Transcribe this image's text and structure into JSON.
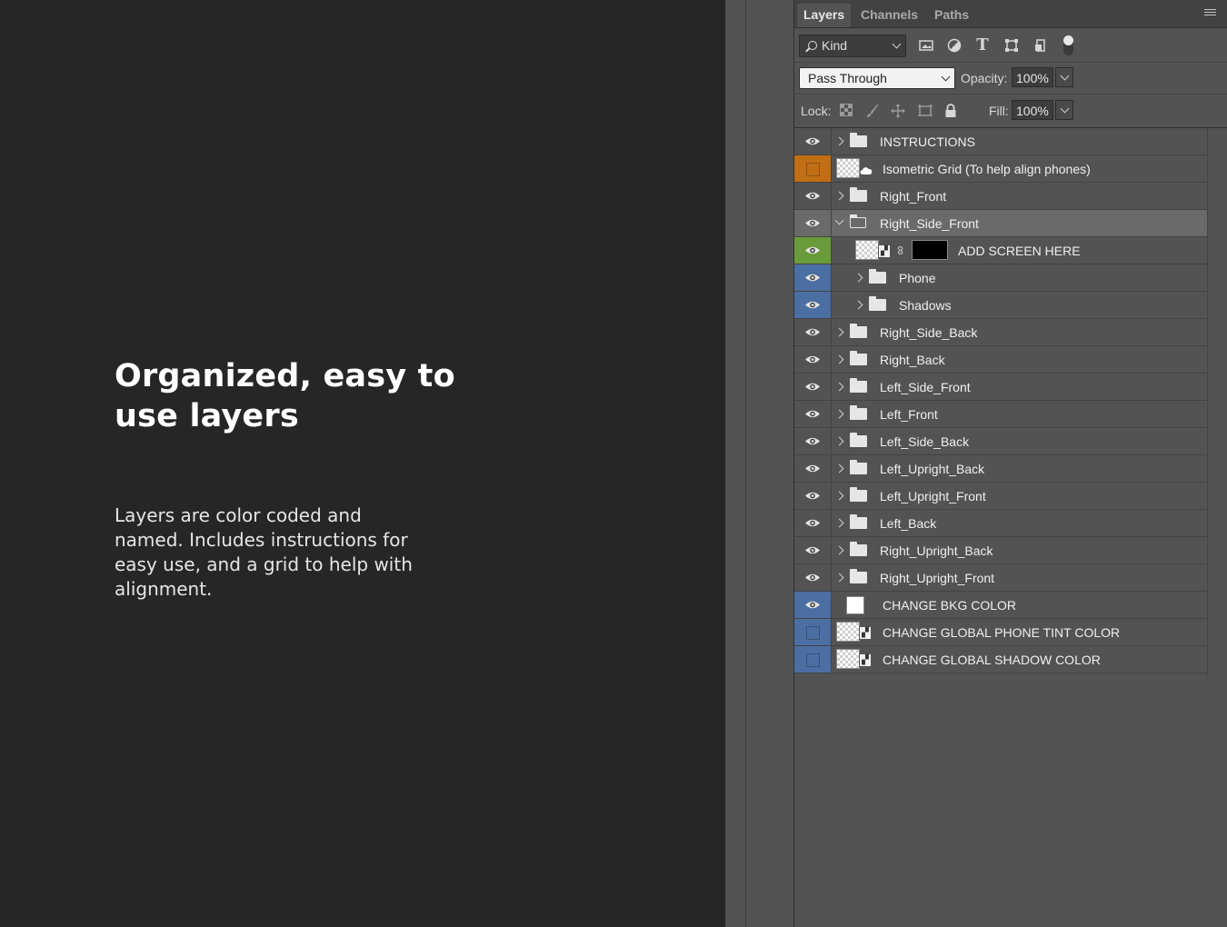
{
  "promo": {
    "headline": "Organized, easy to use layers",
    "description": "Layers are color coded and named. Includes instructions for easy use, and a grid to help with alignment."
  },
  "tabs": [
    {
      "label": "Layers",
      "active": true
    },
    {
      "label": "Channels",
      "active": false
    },
    {
      "label": "Paths",
      "active": false
    }
  ],
  "filter": {
    "kind_label": "Kind",
    "icons": [
      "image-filter-icon",
      "adjustment-filter-icon",
      "type-filter-icon",
      "shape-filter-icon",
      "smart-object-filter-icon"
    ]
  },
  "blend": {
    "mode": "Pass Through",
    "opacity_label": "Opacity:",
    "opacity": "100%",
    "lock_label": "Lock:",
    "fill_label": "Fill:",
    "fill": "100%"
  },
  "colors": {
    "panel": "#535353",
    "orange": "#c16e15",
    "green": "#6a9b3a",
    "blue": "#4b6fa3"
  },
  "layers": [
    {
      "name": "INSTRUCTIONS",
      "type": "group",
      "visible": true,
      "color": "none",
      "indent": 0,
      "expanded": false
    },
    {
      "name": "Isometric Grid (To help align phones)",
      "type": "smart-cloud",
      "visible": false,
      "color": "orange",
      "indent": 0
    },
    {
      "name": "Right_Front",
      "type": "group",
      "visible": true,
      "color": "none",
      "indent": 0,
      "expanded": false
    },
    {
      "name": "Right_Side_Front",
      "type": "group",
      "visible": true,
      "color": "none",
      "indent": 0,
      "expanded": true,
      "selected": true
    },
    {
      "name": "ADD SCREEN HERE",
      "type": "smart-mask",
      "visible": true,
      "color": "green",
      "indent": 1
    },
    {
      "name": "Phone",
      "type": "group",
      "visible": true,
      "color": "blue",
      "indent": 1,
      "expanded": false
    },
    {
      "name": "Shadows",
      "type": "group",
      "visible": true,
      "color": "blue",
      "indent": 1,
      "expanded": false
    },
    {
      "name": "Right_Side_Back",
      "type": "group",
      "visible": true,
      "color": "none",
      "indent": 0,
      "expanded": false
    },
    {
      "name": "Right_Back",
      "type": "group",
      "visible": true,
      "color": "none",
      "indent": 0,
      "expanded": false
    },
    {
      "name": "Left_Side_Front",
      "type": "group",
      "visible": true,
      "color": "none",
      "indent": 0,
      "expanded": false
    },
    {
      "name": "Left_Front",
      "type": "group",
      "visible": true,
      "color": "none",
      "indent": 0,
      "expanded": false
    },
    {
      "name": "Left_Side_Back",
      "type": "group",
      "visible": true,
      "color": "none",
      "indent": 0,
      "expanded": false
    },
    {
      "name": "Left_Upright_Back",
      "type": "group",
      "visible": true,
      "color": "none",
      "indent": 0,
      "expanded": false
    },
    {
      "name": "Left_Upright_Front",
      "type": "group",
      "visible": true,
      "color": "none",
      "indent": 0,
      "expanded": false
    },
    {
      "name": "Left_Back",
      "type": "group",
      "visible": true,
      "color": "none",
      "indent": 0,
      "expanded": false
    },
    {
      "name": "Right_Upright_Back",
      "type": "group",
      "visible": true,
      "color": "none",
      "indent": 0,
      "expanded": false
    },
    {
      "name": "Right_Upright_Front",
      "type": "group",
      "visible": true,
      "color": "none",
      "indent": 0,
      "expanded": false
    },
    {
      "name": "CHANGE BKG COLOR",
      "type": "fill-white",
      "visible": true,
      "color": "blue",
      "indent": 0
    },
    {
      "name": "CHANGE GLOBAL PHONE TINT COLOR",
      "type": "smart",
      "visible": false,
      "color": "blue",
      "indent": 0
    },
    {
      "name": "CHANGE GLOBAL SHADOW COLOR",
      "type": "smart",
      "visible": false,
      "color": "blue",
      "indent": 0
    }
  ]
}
